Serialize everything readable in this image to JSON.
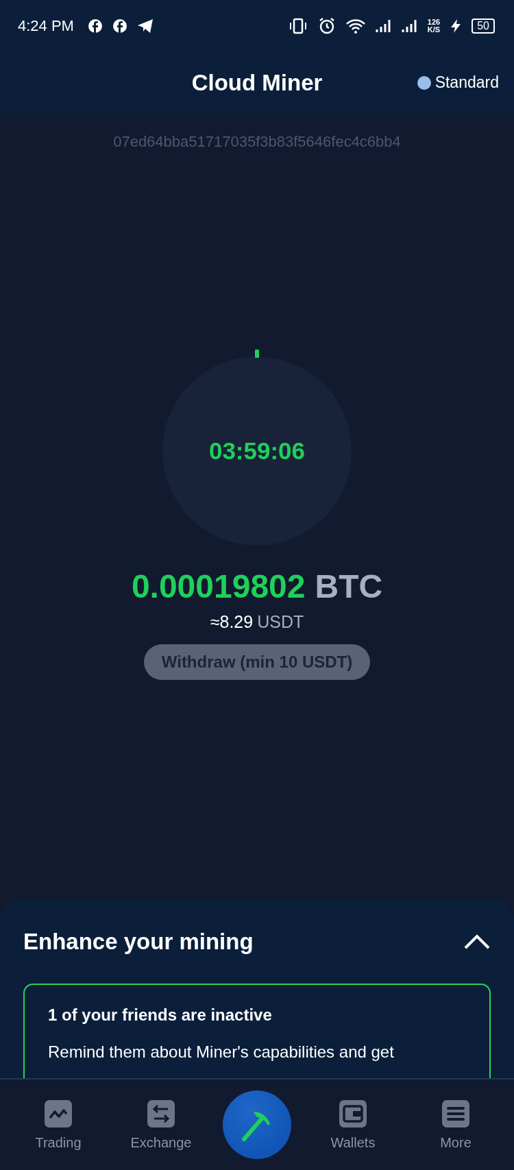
{
  "status_bar": {
    "time": "4:24 PM",
    "net_speed": "126",
    "net_unit": "K/S",
    "battery": "50"
  },
  "header": {
    "title": "Cloud Miner",
    "plan": "Standard"
  },
  "miner_id": "07ed64bba51717035f3b83f5646fec4c6bb4",
  "timer": {
    "time": "03:59:06"
  },
  "balance": {
    "amount": "0.00019802",
    "currency": "BTC",
    "approx": "≈8.29",
    "approx_unit": "USDT"
  },
  "withdraw_button": {
    "label": "Withdraw (min 10 USDT)",
    "disabled": true
  },
  "sheet": {
    "title": "Enhance your mining",
    "expanded": true,
    "card": {
      "title": "1 of your friends are inactive",
      "body": "Remind them about Miner's capabilities and get"
    }
  },
  "nav": [
    {
      "kind": "trading",
      "label": "Trading",
      "selected": false
    },
    {
      "kind": "exchange",
      "label": "Exchange",
      "selected": false
    },
    {
      "kind": "mine",
      "selected": true
    },
    {
      "kind": "wallets",
      "label": "Wallets",
      "selected": false
    },
    {
      "kind": "more",
      "label": "More",
      "selected": false
    }
  ]
}
